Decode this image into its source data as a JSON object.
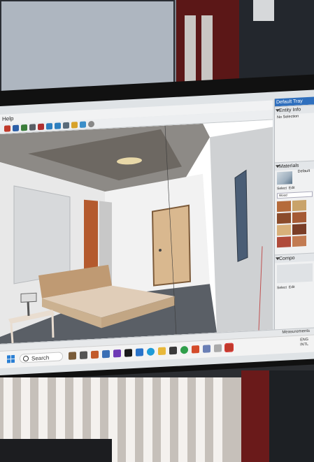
{
  "app": {
    "menu": [
      "Help"
    ],
    "toolbar_icons": [
      "orbit-icon",
      "pan-icon",
      "zoom-icon",
      "zoom-window-icon",
      "zoom-extents-icon",
      "walk-icon",
      "look-around-icon",
      "position-camera-icon",
      "section-icon",
      "scene-icon",
      "settings-icon"
    ]
  },
  "tray": {
    "title": "Default Tray",
    "entity_info": {
      "heading": "Entity Info",
      "selection": "No Selection"
    },
    "materials": {
      "heading": "Materials",
      "current": "Default",
      "tabs": [
        "Select",
        "Edit"
      ],
      "dropdown": "Wood",
      "swatches": [
        "#b56b3b",
        "#c9a36a",
        "#8a4b2b",
        "#a55a35",
        "#d8b07a",
        "#7a3d27",
        "#b04a3a",
        "#c27b52"
      ]
    },
    "components": {
      "heading": "Compo",
      "tabs": [
        "Select",
        "Edit"
      ]
    }
  },
  "status": {
    "measurements_label": "Measurements"
  },
  "taskbar": {
    "search_label": "Search",
    "clock_line1": "ENG",
    "clock_line2": "INTL"
  }
}
